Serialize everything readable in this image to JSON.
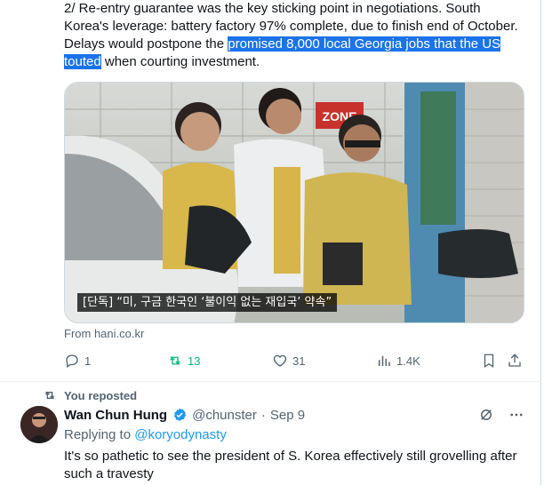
{
  "tweet1": {
    "text_before": "2/ Re-entry guarantee was the key sticking point in negotiations. South Korea's leverage: battery factory 97% complete, due to finish end of October. Delays would postpone the ",
    "text_highlight": "promised 8,000 local Georgia jobs that the US touted",
    "text_after": " when courting investment.",
    "media": {
      "sign_text": "ZONE",
      "caption": "[단독] “미, 구금 한국인 ‘불이익 없는 재입국’ 약속”"
    },
    "source": "From hani.co.kr",
    "actions": {
      "replies": "1",
      "reposts": "13",
      "likes": "31",
      "views": "1.4K"
    }
  },
  "tweet2": {
    "repost_label": "You reposted",
    "author_name": "Wan Chun Hung",
    "handle": "@chunster",
    "dot": "·",
    "date": "Sep 9",
    "replying_label": "Replying to",
    "replying_handle": "@koryodynasty",
    "text": "It's so pathetic to see the president of S. Korea effectively still grovelling after such a travesty"
  },
  "colors": {
    "accent": "#1d9bf0",
    "repost_green": "#00ba7c",
    "muted": "#536471",
    "highlight": "#1a73e8"
  }
}
